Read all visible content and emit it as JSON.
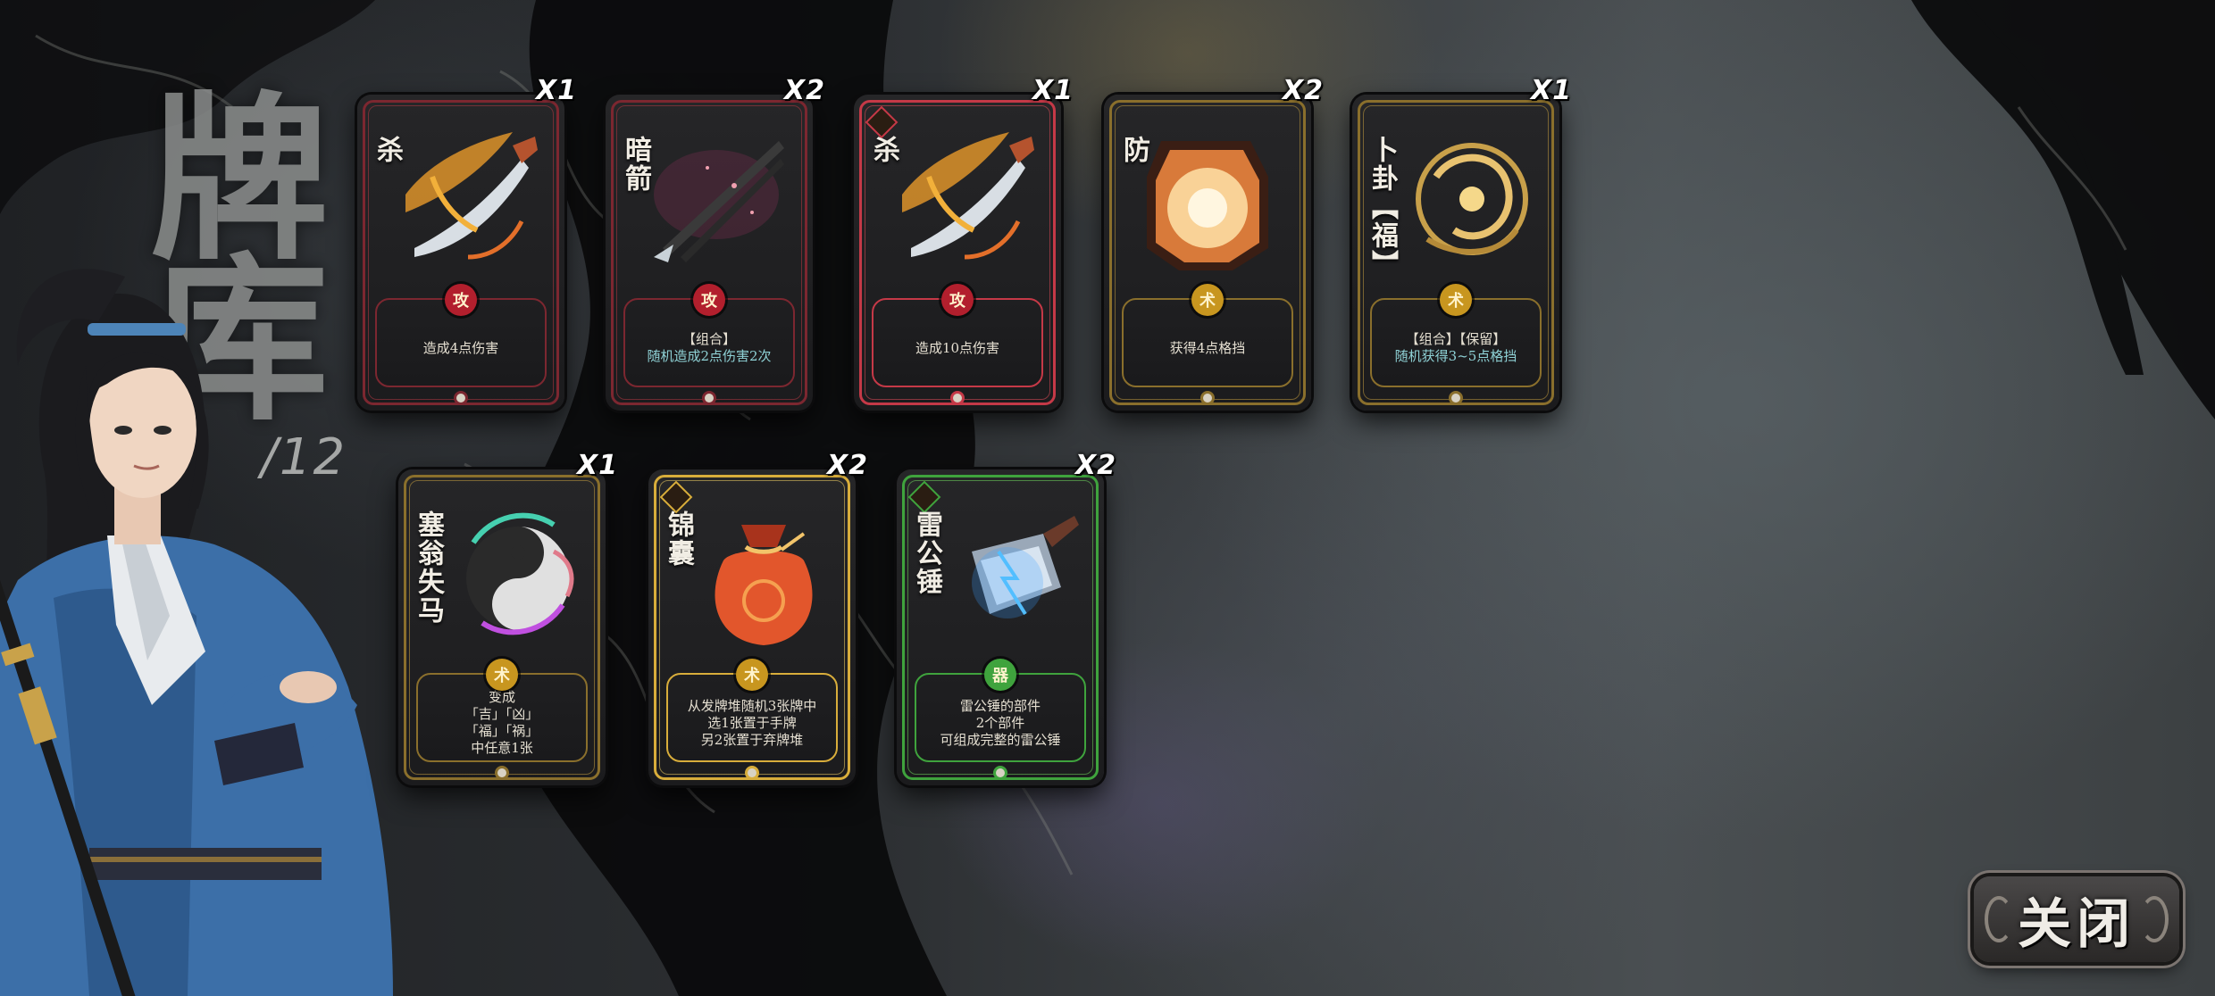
{
  "deck_view": {
    "title": "牌库",
    "count": "12",
    "close_label": "关闭"
  },
  "cards": [
    {
      "name": "杀",
      "qty": "X1",
      "desc": [
        "造成4点伤害"
      ],
      "frame": "red",
      "emblem": "攻"
    },
    {
      "name": "暗箭",
      "qty": "X2",
      "desc": [
        "【组合】",
        "随机造成2点伤害2次"
      ],
      "frame": "red",
      "emblem": "攻"
    },
    {
      "name": "杀",
      "qty": "X1",
      "desc": [
        "造成10点伤害"
      ],
      "frame": "red-bright",
      "emblem": "攻"
    },
    {
      "name": "防",
      "qty": "X2",
      "desc": [
        "获得4点格挡"
      ],
      "frame": "gold",
      "emblem": "术"
    },
    {
      "name": "卜卦【福】",
      "qty": "X1",
      "desc": [
        "【组合】【保留】",
        "随机获得3~5点格挡"
      ],
      "frame": "gold",
      "emblem": "术"
    },
    {
      "name": "塞翁失马",
      "qty": "X1",
      "desc": [
        "变成",
        "「吉」「凶」",
        "「福」「祸」",
        "中任意1张"
      ],
      "frame": "gold",
      "emblem": "术"
    },
    {
      "name": "锦囊",
      "qty": "X2",
      "desc": [
        "从发牌堆随机3张牌中",
        "选1张置于手牌",
        "另2张置于弃牌堆"
      ],
      "frame": "gold-bright",
      "emblem": "术"
    },
    {
      "name": "雷公锤",
      "qty": "X2",
      "desc": [
        "雷公锤的部件",
        "2个部件",
        "可组成完整的雷公锤"
      ],
      "frame": "green",
      "emblem": "器"
    }
  ],
  "colors": {
    "frame_red": "#7c2730",
    "frame_red_bright": "#c53947",
    "frame_gold": "#8a6f2c",
    "frame_gold_bright": "#d8ad3b",
    "frame_green": "#3fa33d",
    "desc_highlight": "#8fd2d6"
  },
  "icons": [
    "blade-icon",
    "arrow-icon",
    "lantern-shield-icon",
    "bagua-talisman-icon",
    "horse-yinyang-icon",
    "brocade-pouch-icon",
    "thunder-hammer-icon"
  ]
}
